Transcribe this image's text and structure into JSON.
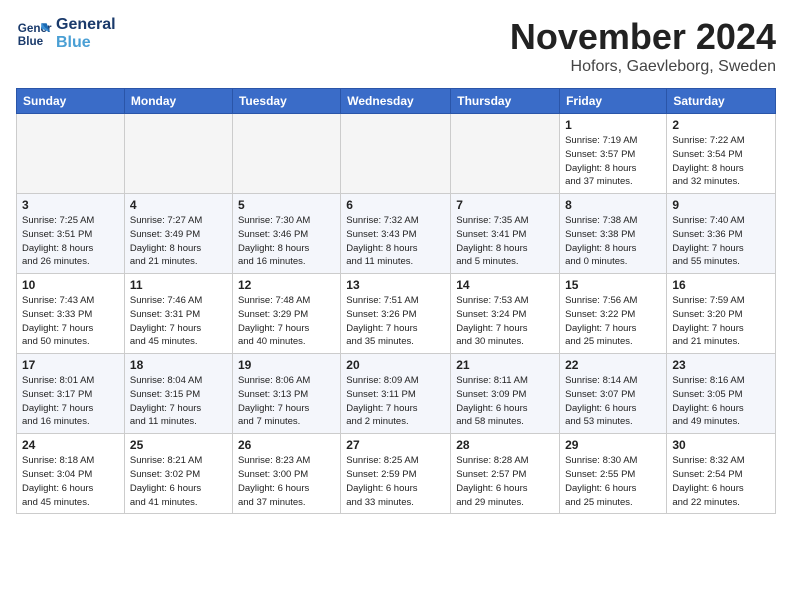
{
  "logo": {
    "line1": "General",
    "line2": "Blue"
  },
  "title": "November 2024",
  "location": "Hofors, Gaevleborg, Sweden",
  "weekdays": [
    "Sunday",
    "Monday",
    "Tuesday",
    "Wednesday",
    "Thursday",
    "Friday",
    "Saturday"
  ],
  "weeks": [
    [
      {
        "day": "",
        "info": ""
      },
      {
        "day": "",
        "info": ""
      },
      {
        "day": "",
        "info": ""
      },
      {
        "day": "",
        "info": ""
      },
      {
        "day": "",
        "info": ""
      },
      {
        "day": "1",
        "info": "Sunrise: 7:19 AM\nSunset: 3:57 PM\nDaylight: 8 hours\nand 37 minutes."
      },
      {
        "day": "2",
        "info": "Sunrise: 7:22 AM\nSunset: 3:54 PM\nDaylight: 8 hours\nand 32 minutes."
      }
    ],
    [
      {
        "day": "3",
        "info": "Sunrise: 7:25 AM\nSunset: 3:51 PM\nDaylight: 8 hours\nand 26 minutes."
      },
      {
        "day": "4",
        "info": "Sunrise: 7:27 AM\nSunset: 3:49 PM\nDaylight: 8 hours\nand 21 minutes."
      },
      {
        "day": "5",
        "info": "Sunrise: 7:30 AM\nSunset: 3:46 PM\nDaylight: 8 hours\nand 16 minutes."
      },
      {
        "day": "6",
        "info": "Sunrise: 7:32 AM\nSunset: 3:43 PM\nDaylight: 8 hours\nand 11 minutes."
      },
      {
        "day": "7",
        "info": "Sunrise: 7:35 AM\nSunset: 3:41 PM\nDaylight: 8 hours\nand 5 minutes."
      },
      {
        "day": "8",
        "info": "Sunrise: 7:38 AM\nSunset: 3:38 PM\nDaylight: 8 hours\nand 0 minutes."
      },
      {
        "day": "9",
        "info": "Sunrise: 7:40 AM\nSunset: 3:36 PM\nDaylight: 7 hours\nand 55 minutes."
      }
    ],
    [
      {
        "day": "10",
        "info": "Sunrise: 7:43 AM\nSunset: 3:33 PM\nDaylight: 7 hours\nand 50 minutes."
      },
      {
        "day": "11",
        "info": "Sunrise: 7:46 AM\nSunset: 3:31 PM\nDaylight: 7 hours\nand 45 minutes."
      },
      {
        "day": "12",
        "info": "Sunrise: 7:48 AM\nSunset: 3:29 PM\nDaylight: 7 hours\nand 40 minutes."
      },
      {
        "day": "13",
        "info": "Sunrise: 7:51 AM\nSunset: 3:26 PM\nDaylight: 7 hours\nand 35 minutes."
      },
      {
        "day": "14",
        "info": "Sunrise: 7:53 AM\nSunset: 3:24 PM\nDaylight: 7 hours\nand 30 minutes."
      },
      {
        "day": "15",
        "info": "Sunrise: 7:56 AM\nSunset: 3:22 PM\nDaylight: 7 hours\nand 25 minutes."
      },
      {
        "day": "16",
        "info": "Sunrise: 7:59 AM\nSunset: 3:20 PM\nDaylight: 7 hours\nand 21 minutes."
      }
    ],
    [
      {
        "day": "17",
        "info": "Sunrise: 8:01 AM\nSunset: 3:17 PM\nDaylight: 7 hours\nand 16 minutes."
      },
      {
        "day": "18",
        "info": "Sunrise: 8:04 AM\nSunset: 3:15 PM\nDaylight: 7 hours\nand 11 minutes."
      },
      {
        "day": "19",
        "info": "Sunrise: 8:06 AM\nSunset: 3:13 PM\nDaylight: 7 hours\nand 7 minutes."
      },
      {
        "day": "20",
        "info": "Sunrise: 8:09 AM\nSunset: 3:11 PM\nDaylight: 7 hours\nand 2 minutes."
      },
      {
        "day": "21",
        "info": "Sunrise: 8:11 AM\nSunset: 3:09 PM\nDaylight: 6 hours\nand 58 minutes."
      },
      {
        "day": "22",
        "info": "Sunrise: 8:14 AM\nSunset: 3:07 PM\nDaylight: 6 hours\nand 53 minutes."
      },
      {
        "day": "23",
        "info": "Sunrise: 8:16 AM\nSunset: 3:05 PM\nDaylight: 6 hours\nand 49 minutes."
      }
    ],
    [
      {
        "day": "24",
        "info": "Sunrise: 8:18 AM\nSunset: 3:04 PM\nDaylight: 6 hours\nand 45 minutes."
      },
      {
        "day": "25",
        "info": "Sunrise: 8:21 AM\nSunset: 3:02 PM\nDaylight: 6 hours\nand 41 minutes."
      },
      {
        "day": "26",
        "info": "Sunrise: 8:23 AM\nSunset: 3:00 PM\nDaylight: 6 hours\nand 37 minutes."
      },
      {
        "day": "27",
        "info": "Sunrise: 8:25 AM\nSunset: 2:59 PM\nDaylight: 6 hours\nand 33 minutes."
      },
      {
        "day": "28",
        "info": "Sunrise: 8:28 AM\nSunset: 2:57 PM\nDaylight: 6 hours\nand 29 minutes."
      },
      {
        "day": "29",
        "info": "Sunrise: 8:30 AM\nSunset: 2:55 PM\nDaylight: 6 hours\nand 25 minutes."
      },
      {
        "day": "30",
        "info": "Sunrise: 8:32 AM\nSunset: 2:54 PM\nDaylight: 6 hours\nand 22 minutes."
      }
    ]
  ]
}
